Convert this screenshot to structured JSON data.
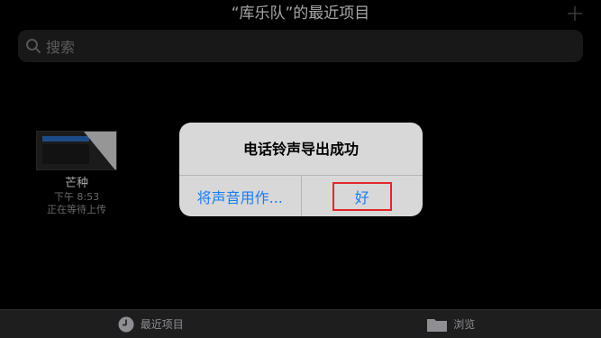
{
  "header": {
    "title": "“库乐队”的最近项目",
    "add_icon": "plus-icon"
  },
  "search": {
    "placeholder": "搜索",
    "icon": "search-icon"
  },
  "files": [
    {
      "name": "芒种",
      "time": "下午 8:53",
      "status": "正在等待上传"
    }
  ],
  "alert": {
    "title": "电话铃声导出成功",
    "secondary_button": "将声音用作...",
    "primary_button": "好",
    "highlight_color": "#e3262b"
  },
  "tabbar": {
    "tabs": [
      {
        "label": "最近项目",
        "icon": "clock-icon"
      },
      {
        "label": "浏览",
        "icon": "folder-icon"
      }
    ]
  },
  "colors": {
    "accent": "#1a7cf2",
    "background": "#000000"
  }
}
